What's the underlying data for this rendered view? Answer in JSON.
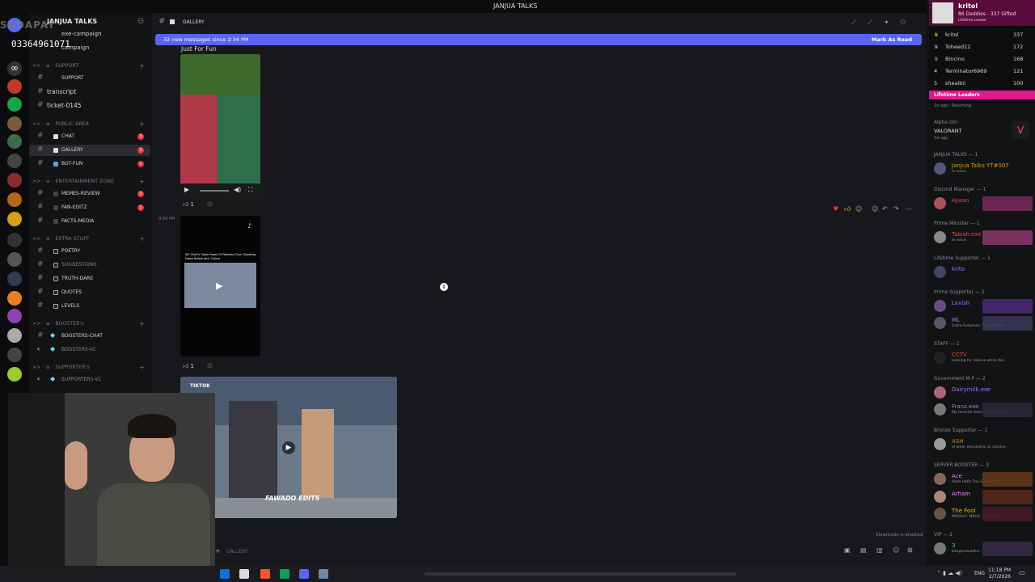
{
  "window": {
    "title": "JANJUA TALKS"
  },
  "overlay": {
    "watermark": "SADAPAY",
    "phone": "03364961071"
  },
  "server": {
    "name": "JANJUA TALKS"
  },
  "sidebar": {
    "top_items": [
      {
        "label": "exe-campaign"
      },
      {
        "label": "campaign"
      }
    ],
    "categories": [
      {
        "label": "SUPPORT"
      },
      {
        "label": "PUBLIC AREA"
      },
      {
        "label": "ENTERTAINMENT ZONE"
      },
      {
        "label": "EXTRA STUFF"
      },
      {
        "label": "BOOSTER's"
      },
      {
        "label": "SUPPORTER's"
      }
    ],
    "channels": [
      {
        "label": "SUPPORT"
      },
      {
        "label": "transcript"
      },
      {
        "label": "ticket-0145"
      },
      {
        "label": "CHAT",
        "badge": "3"
      },
      {
        "label": "GALLERY",
        "badge": "3"
      },
      {
        "label": "BOT-FUN",
        "badge": "1"
      },
      {
        "label": "MEMES-REVIEW",
        "badge": "3"
      },
      {
        "label": "FAN-EDITZ",
        "badge": "1"
      },
      {
        "label": "FACTS-MEDIA"
      },
      {
        "label": "POETRY"
      },
      {
        "label": "SUGGESTIONS"
      },
      {
        "label": "TRUTH-DARE"
      },
      {
        "label": "QUOTES"
      },
      {
        "label": "LEVELS"
      },
      {
        "label": "BOOSTERS-CHAT"
      },
      {
        "label": "BOOSTERS-VC"
      },
      {
        "label": "SUPPORTERS-VC"
      }
    ]
  },
  "channel_header": {
    "name": "GALLERY"
  },
  "new_messages_bar": {
    "text": "32 new messages since 2:34 PM",
    "action": "Mark As Read"
  },
  "messages": [
    {
      "text": "Just For Fun",
      "reaction_count": "1"
    },
    {
      "timestamp": "9:34 PM",
      "video_caption": "IAF Chief's Stoke Roast Of Pakistan Over Shooting Down Rafale Jets' Claims",
      "reaction_count": "1"
    },
    {
      "video_caption": "FAWADO EDITS",
      "tag": "TIKTOK"
    }
  ],
  "composer": {
    "placeholder": "GALLERY",
    "slowmode": "Slowmode is enabled"
  },
  "leaderboard": {
    "top_name": "kritol",
    "top_sub": "86 Daddies - 337 Gifted",
    "top_sub2": "Lifetime Leader",
    "rows": [
      {
        "rank": "1",
        "name": "kritol",
        "score": "337"
      },
      {
        "rank": "2",
        "name": "Toheed12",
        "score": "172"
      },
      {
        "rank": "3",
        "name": "Bincino",
        "score": "168"
      },
      {
        "rank": "4",
        "name": "Terminator6969",
        "score": "121"
      },
      {
        "rank": "5",
        "name": "sheaibii",
        "score": "100"
      }
    ],
    "footer": "Lifetime Leaders"
  },
  "members": {
    "pre_items": [
      {
        "status": "1d ago · Returning"
      },
      {
        "name": "Alpha Ghi",
        "sub": "VALORANT",
        "when": "1d ago"
      }
    ],
    "groups": [
      {
        "label": "JANJUA TALKS — 1",
        "members": [
          {
            "name": "Janjua Talks YT#007",
            "status": "In voice",
            "color": "#d4a017"
          }
        ]
      },
      {
        "label": "Discord Manager — 1",
        "members": [
          {
            "name": "Ayaan",
            "status": "",
            "color": "#e74c3c"
          }
        ]
      },
      {
        "label": "Prime Minister — 1",
        "members": [
          {
            "name": "Tabish.exe",
            "status": "In voice",
            "color": "#e74c3c"
          }
        ]
      },
      {
        "label": "Lifetime Supporter — 1",
        "members": [
          {
            "name": "krito",
            "status": "",
            "color": "#a970ff"
          }
        ]
      },
      {
        "label": "Prime Supporter — 2",
        "members": [
          {
            "name": "Lvxish",
            "status": "",
            "color": "#a970ff"
          },
          {
            "name": "ML",
            "status": "Salim-Sulaiman, Sonu Nigam",
            "color": "#a970ff"
          }
        ]
      },
      {
        "label": "STAFF — 1",
        "members": [
          {
            "name": "CCTV",
            "status": "Looking for silence while the...",
            "color": "#e74c3c"
          }
        ]
      },
      {
        "label": "Government M.P — 2",
        "members": [
          {
            "name": "Dairymilk.exe",
            "status": "",
            "color": "#a970ff"
          },
          {
            "name": "Franz.exe",
            "status": "My favorite loser is me, becau...",
            "color": "#a970ff"
          }
        ]
      },
      {
        "label": "Bronze Supporter — 1",
        "members": [
          {
            "name": "ASH",
            "status": "el amor encuentra un camino",
            "color": "#cd7f32"
          }
        ]
      },
      {
        "label": "SERVER BOOSTER — 3",
        "members": [
          {
            "name": "Ace",
            "status": "Allah Hafiz The Sun Ain't...",
            "color": "#f47fff"
          },
          {
            "name": "Arham",
            "status": "",
            "color": "#f47fff"
          },
          {
            "name": "The Fool",
            "status": "MASHLE: MAGIC AND MUSC...",
            "color": "#f1c40f"
          }
        ]
      },
      {
        "label": "VIP — 2",
        "members": [
          {
            "name": "3",
            "status": "bangmeoutthe...",
            "color": "#2ecc71"
          }
        ]
      }
    ]
  },
  "taskbar": {
    "lang": "ENG",
    "time": "11:18 PM",
    "date": "2/7/2026"
  },
  "colors": {
    "accent": "#5865f2",
    "badge": "#e23b3b",
    "lb_footer": "#e0188a"
  }
}
